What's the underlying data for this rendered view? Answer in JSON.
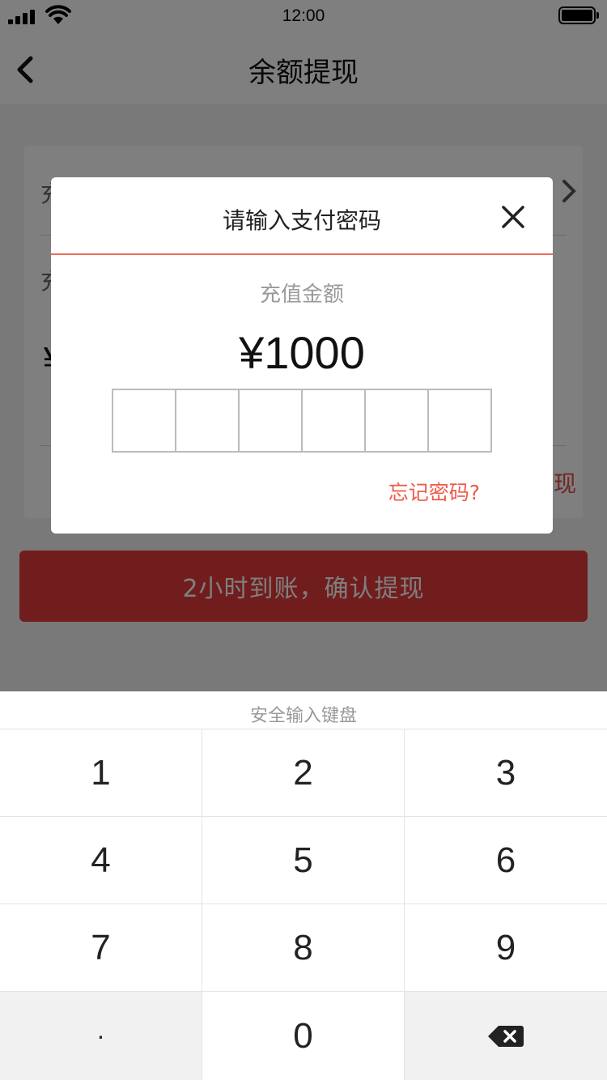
{
  "status_bar": {
    "time": "12:00"
  },
  "nav": {
    "title": "余额提现",
    "back_icon": "chevron-left-icon"
  },
  "background": {
    "row1_label": "充",
    "row2_label": "充",
    "yen": "¥",
    "red_text": "现",
    "confirm_button": "2小时到账，确认提现"
  },
  "dialog": {
    "title": "请输入支付密码",
    "close_icon": "close-icon",
    "amount_label": "充值金额",
    "amount_value": "¥1000",
    "pin_length": 6,
    "forgot_link": "忘记密码?"
  },
  "keyboard": {
    "title": "安全输入键盘",
    "keys": [
      "1",
      "2",
      "3",
      "4",
      "5",
      "6",
      "7",
      "8",
      "9",
      "·",
      "0"
    ],
    "backspace_icon": "backspace-icon"
  }
}
